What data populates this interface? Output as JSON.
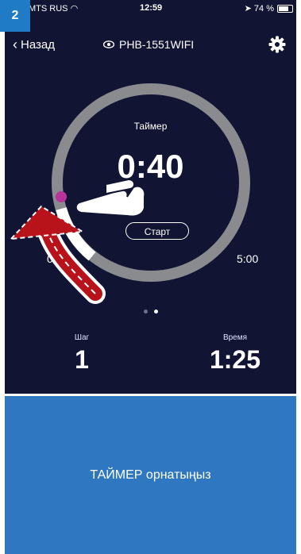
{
  "step_badge": "2",
  "status_bar": {
    "carrier": "MTS RUS",
    "time": "12:59",
    "battery": "74 %",
    "battery_level": 0.74
  },
  "nav": {
    "back_label": "Назад",
    "device_name": "PHB-1551WIFI"
  },
  "timer": {
    "label": "Таймер",
    "value": "0:40",
    "start_label": "Старт",
    "min_label": "0:05",
    "max_label": "5:00"
  },
  "pager": {
    "count": 2,
    "active_index": 1
  },
  "stats": {
    "step_label": "Шаг",
    "step_value": "1",
    "time_label": "Время",
    "time_value": "1:25"
  },
  "caption": "ТАЙМЕР орнатыңыз",
  "colors": {
    "background": "#111533",
    "ring": "#8a8b8f",
    "ring_active": "#ffffff",
    "handle": "#b8339a",
    "badge": "#1f7bc6",
    "caption_bg": "#2f77c0",
    "arrow": "#b8121b"
  }
}
